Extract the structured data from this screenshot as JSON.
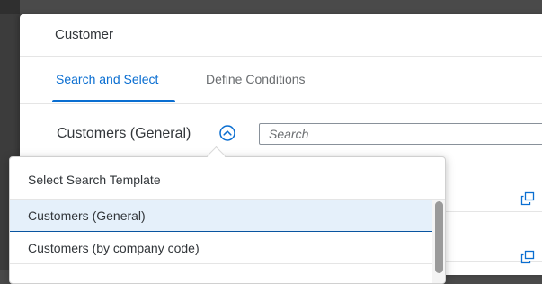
{
  "dialog": {
    "title": "Customer"
  },
  "tabs": [
    {
      "label": "Search and Select",
      "active": true
    },
    {
      "label": "Define Conditions",
      "active": false
    }
  ],
  "search_template": {
    "label": "Customers (General)",
    "toggle_icon": "chevron-up-circle-icon",
    "expanded": true
  },
  "search": {
    "placeholder": "Search",
    "value": ""
  },
  "result_rows_icon": "value-help-icon",
  "popover": {
    "title": "Select Search Template",
    "options": [
      {
        "label": "Customers (General)",
        "selected": true
      },
      {
        "label": "Customers (by company code)",
        "selected": false
      }
    ]
  },
  "colors": {
    "accent": "#0a6ed1",
    "text": "#32363a",
    "muted": "#6a6d70",
    "selected_bg": "#e5f0fa",
    "overlay": "#4a4a4a"
  }
}
